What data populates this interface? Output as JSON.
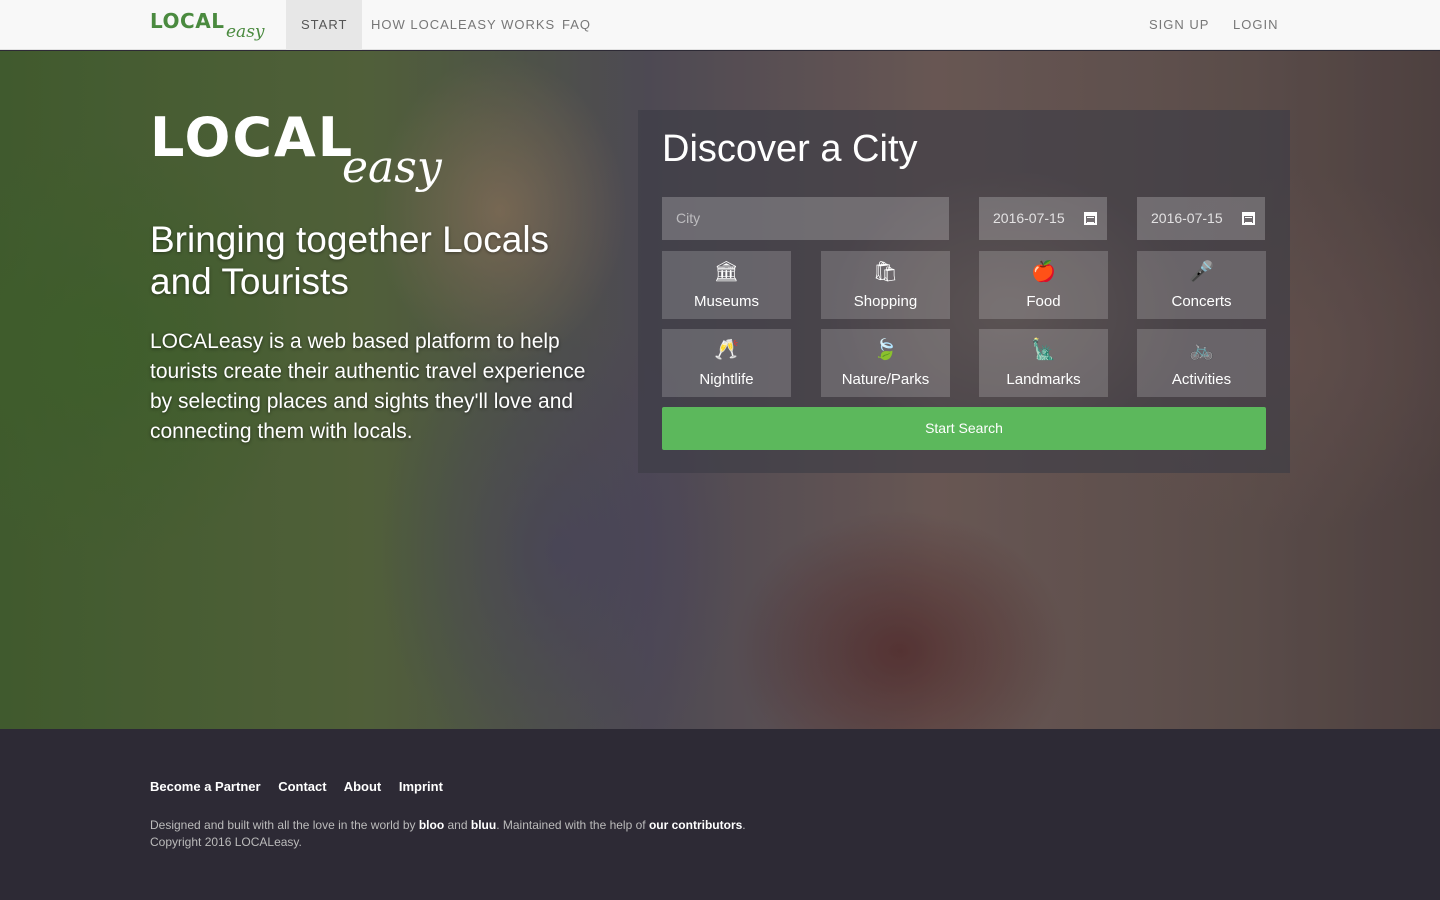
{
  "navbar": {
    "logo_main": "LOCAL",
    "logo_script": "easy",
    "links": [
      "START",
      "HOW LOCALEASY WORKS",
      "FAQ"
    ],
    "right_links": [
      "SIGN UP",
      "LOGIN"
    ]
  },
  "hero": {
    "logo_main": "LOCAL",
    "logo_script": "easy",
    "title": "Bringing together Locals and Tourists",
    "description": "LOCALeasy is a web based platform to help tourists create their authentic travel experience by selecting places and sights they'll love and connecting them with locals."
  },
  "search": {
    "title": "Discover a City",
    "city_placeholder": "City",
    "date_from": "2016-07-15",
    "date_to": "2016-07-15",
    "categories": [
      {
        "label": "Museums",
        "icon": "museum-icon",
        "glyph": "🏛"
      },
      {
        "label": "Shopping",
        "icon": "shopping-bag-icon",
        "glyph": "🛍"
      },
      {
        "label": "Food",
        "icon": "food-icon",
        "glyph": "🍎"
      },
      {
        "label": "Concerts",
        "icon": "concert-icon",
        "glyph": "🎤"
      },
      {
        "label": "Nightlife",
        "icon": "nightlife-icon",
        "glyph": "🥂"
      },
      {
        "label": "Nature/Parks",
        "icon": "leaf-icon",
        "glyph": "🍃"
      },
      {
        "label": "Landmarks",
        "icon": "landmark-icon",
        "glyph": "🗽"
      },
      {
        "label": "Activities",
        "icon": "bicycle-icon",
        "glyph": "🚲"
      }
    ],
    "button": "Start Search"
  },
  "footer": {
    "links": [
      "Become a Partner",
      "Contact",
      "About",
      "Imprint"
    ],
    "credit_pre": "Designed and built with all the love in the world by ",
    "credit_a": "bloo",
    "credit_and": " and ",
    "credit_b": "bluu",
    "credit_mid": ". Maintained with the help of ",
    "credit_c": "our contributors",
    "credit_end": ".",
    "copyright": "Copyright 2016 LOCALeasy."
  },
  "colors": {
    "accent": "#5cb85c",
    "logo_green": "#4a8a3f",
    "footer_bg": "#2d2a35"
  }
}
